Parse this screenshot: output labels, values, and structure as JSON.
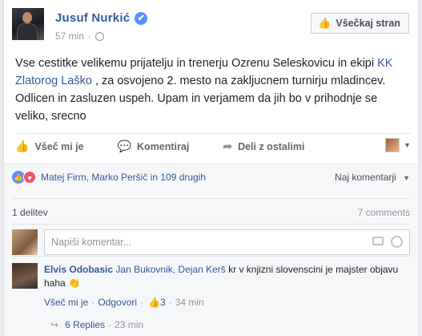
{
  "post": {
    "author": "Jusuf Nurkić",
    "time": "57 min",
    "dot": "·",
    "like_page_label": "Všečkaj stran",
    "text_part1": "Vse cestitke velikemu prijatelju in trenerju Ozrenu Seleskovicu in ekipi ",
    "link_text": "KK Zlatorog Laško",
    "text_part2": " , za osvojeno 2. mesto na zakljucnem turnirju mladincev. Odlicen in zasluzen uspeh. Upam in verjamem da jih bo v prihodnje se veliko, srecno"
  },
  "actions": {
    "like": "Všeč mi je",
    "comment": "Komentiraj",
    "share": "Deli z ostalimi"
  },
  "reactions": {
    "people": "Matej Firm, Marko Peršič in 109 drugih",
    "top_comments": "Naj komentarji"
  },
  "counts": {
    "shares": "1 delitev",
    "comments": "7 comments"
  },
  "composer": {
    "placeholder": "Napiši komentar..."
  },
  "comment": {
    "author": "Elvis Odobasic",
    "tags": "Jan Bukovnik, Dejan Kerš",
    "text": " kr v knjizni slovenscini je majster objavu haha ",
    "emoji": "👏",
    "like_label": "Všeč mi je",
    "reply_label": "Odgovori",
    "like_count": "3",
    "time": "34 min",
    "sep": "·"
  },
  "replies": {
    "label": "6 Replies",
    "time": "23 min",
    "sep": "·"
  },
  "icons": {
    "verified": "✔",
    "thumb": "👍",
    "comment": "💬",
    "share": "➦",
    "heart": "♥",
    "caret": "▼",
    "reply_arrow": "↪"
  }
}
